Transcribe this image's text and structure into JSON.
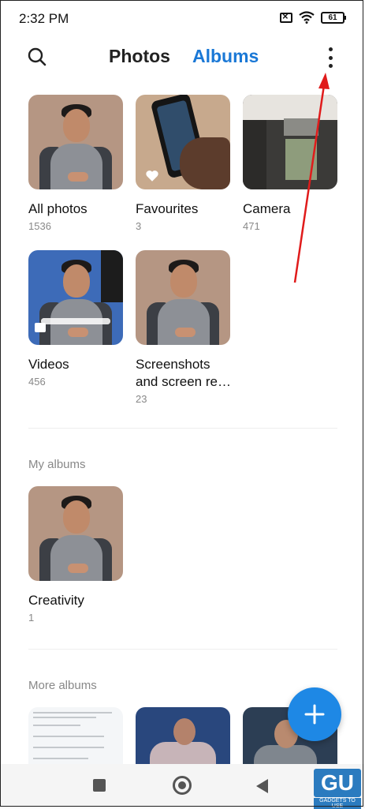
{
  "status_bar": {
    "time": "2:32 PM",
    "battery": "61"
  },
  "header": {
    "tabs": [
      {
        "label": "Photos",
        "active": false
      },
      {
        "label": "Albums",
        "active": true
      }
    ]
  },
  "colors": {
    "accent": "#1a78d6",
    "fab": "#1e88e5"
  },
  "albums": [
    {
      "name": "All photos",
      "count": "1536"
    },
    {
      "name": "Favourites",
      "count": "3"
    },
    {
      "name": "Camera",
      "count": "471"
    },
    {
      "name": "Videos",
      "count": "456"
    },
    {
      "name": "Screenshots and screen re…",
      "count": "23"
    }
  ],
  "my_albums": {
    "title": "My albums",
    "items": [
      {
        "name": "Creativity",
        "count": "1"
      }
    ]
  },
  "more_albums": {
    "title": "More albums"
  },
  "watermark": {
    "logo": "GU",
    "text": "GADGETS TO USE"
  }
}
